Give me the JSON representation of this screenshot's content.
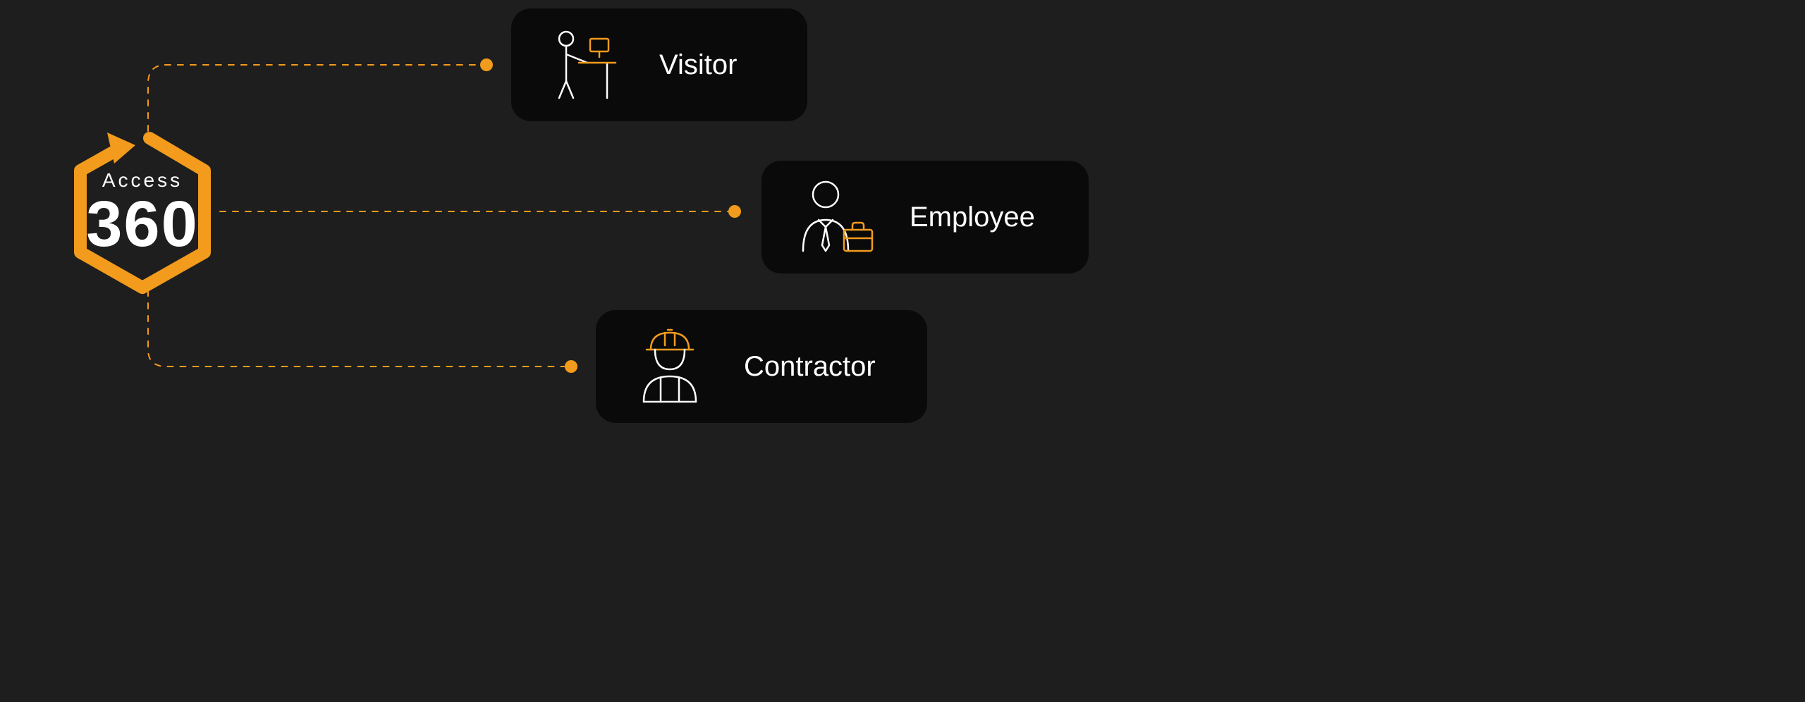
{
  "brand": {
    "sub": "Access",
    "big": "360",
    "accent": "#f29b1d"
  },
  "cards": {
    "visitor": {
      "label": "Visitor"
    },
    "employee": {
      "label": "Employee"
    },
    "contractor": {
      "label": "Contractor"
    }
  }
}
